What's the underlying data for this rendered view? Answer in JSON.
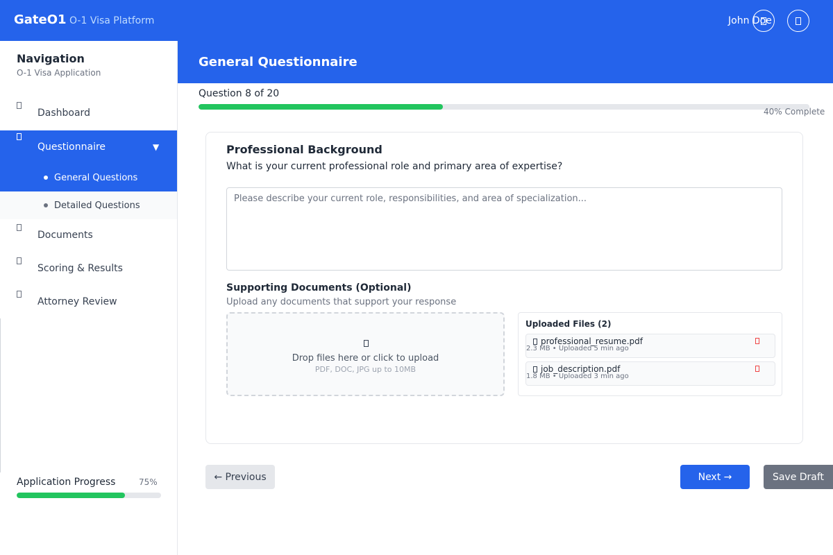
{
  "header": {
    "brand": "GateO1",
    "brand_sub": "O-1 Visa Platform",
    "user_name": "John Doe",
    "icons": [
      "bell-icon",
      "user-icon"
    ]
  },
  "sidebar": {
    "title": "Navigation",
    "subtitle": "O-1 Visa Application",
    "items": [
      {
        "label": "Dashboard",
        "icon": "dashboard-icon"
      },
      {
        "label": "Questionnaire",
        "icon": "questionnaire-icon",
        "active": true,
        "expanded_caret": "▼"
      },
      {
        "label": "Documents",
        "icon": "documents-icon"
      },
      {
        "label": "Scoring & Results",
        "icon": "scoring-icon"
      },
      {
        "label": "Attorney Review",
        "icon": "attorney-icon"
      }
    ],
    "subitems": [
      {
        "label": "General Questions",
        "active": true
      },
      {
        "label": "Detailed Questions",
        "active": false
      }
    ],
    "progress": {
      "label": "Application Progress",
      "percent_label": "75%",
      "value": 0.75
    }
  },
  "main": {
    "title": "General Questionnaire",
    "question_counter": "Question 8 of 20",
    "progress_value": 0.4,
    "progress_label": "40% Complete",
    "section_title": "Professional Background",
    "question": "What is your current professional role and primary area of expertise?",
    "answer_placeholder": "Please describe your current role, responsibilities, and area of specialization...",
    "docs_title": "Supporting Documents (Optional)",
    "docs_subtitle": "Upload any documents that support your response",
    "dropzone_text": "Drop files here or click to upload",
    "dropzone_sub": "PDF, DOC, JPG up to 10MB",
    "uploaded_title": "Uploaded Files (2)",
    "files": [
      {
        "name": "professional_resume.pdf",
        "meta": "2.3 MB • Uploaded 5 min ago"
      },
      {
        "name": "job_description.pdf",
        "meta": "1.8 MB • Uploaded 3 min ago"
      }
    ],
    "buttons": {
      "previous": "← Previous",
      "next": "Next →",
      "save": "Save Draft"
    }
  },
  "colors": {
    "primary": "#2563eb",
    "progress": "#22c55e",
    "danger": "#ef4444",
    "neutral": "#6b7280"
  }
}
